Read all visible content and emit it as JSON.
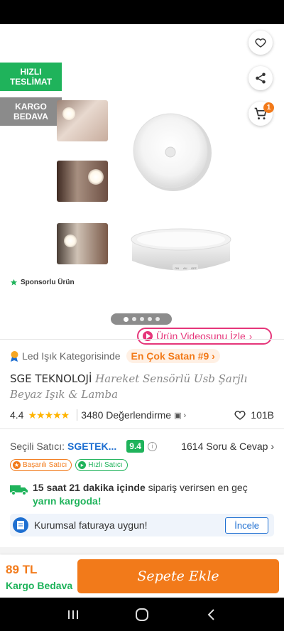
{
  "header": {
    "back_icon": "arrow-left-icon",
    "favorite_icon": "heart-icon",
    "share_icon": "share-icon",
    "cart_icon": "cart-icon",
    "cart_count": "1"
  },
  "tags": {
    "fast_delivery": "HIZLI TESLİMAT",
    "free_cargo": "KARGO BEDAVA"
  },
  "gallery": {
    "sponsored_label": "Sponsorlu Ürün",
    "video_button_label": "Ürün Videosunu İzle",
    "switch_labels": [
      "ON",
      "AU",
      "OFF"
    ]
  },
  "product": {
    "category_text": "Led Işık Kategorisinde",
    "rank_badge": "En Çok Satan #9",
    "brand": "SGE TEKNOLOJİ",
    "name": "Hareket Sensörlü Usb Şarjlı Beyaz Işık & Lamba",
    "rating_value": "4.4",
    "reviews_label": "3480 Değerlendirme",
    "favorites_count": "101B"
  },
  "seller": {
    "label": "Seçili Satıcı:",
    "name": "SGETEK...",
    "score": "9.4",
    "qa_label": "1614 Soru & Cevap",
    "badges": [
      "Başarılı Satıcı",
      "Hızlı Satıcı"
    ]
  },
  "delivery": {
    "bold_part": "15 saat 21 dakika içinde",
    "normal_part": "sipariş verirsen en geç",
    "highlight": "yarın kargoda!"
  },
  "invoice": {
    "text": "Kurumsal faturaya uygun!",
    "button_label": "İncele"
  },
  "bottom": {
    "price": "89 TL",
    "cargo_label": "Kargo Bedava",
    "add_to_cart": "Sepete Ekle"
  },
  "colors": {
    "brand_orange": "#f27a1a",
    "green": "#1fb35b",
    "link_blue": "#1e6fd1",
    "video_pink": "#e5367a"
  }
}
